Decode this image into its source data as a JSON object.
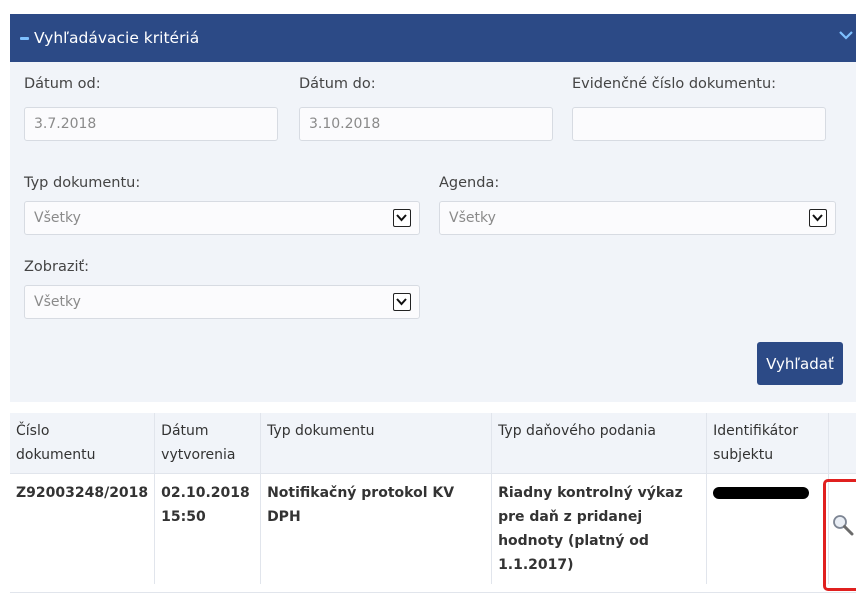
{
  "panel": {
    "title": "Vyhľadávacie kritériá",
    "accent_color": "#2c4a86"
  },
  "filters": {
    "date_from": {
      "label": "Dátum od:",
      "value": "3.7.2018"
    },
    "date_to": {
      "label": "Dátum do:",
      "value": "3.10.2018"
    },
    "evidence_number": {
      "label": "Evidenčné číslo dokumentu:",
      "value": ""
    },
    "document_type": {
      "label": "Typ dokumentu:",
      "value": "Všetky"
    },
    "agenda": {
      "label": "Agenda:",
      "value": "Všetky"
    },
    "show": {
      "label": "Zobraziť:",
      "value": "Všetky"
    }
  },
  "search_button": {
    "label": "Vyhľadať"
  },
  "table": {
    "headers": {
      "doc_number_1": "Číslo",
      "doc_number_2": "dokumentu",
      "created_1": "Dátum",
      "created_2": "vytvorenia",
      "doc_type": "Typ dokumentu",
      "filing_type": "Typ daňového podania",
      "subject_1": "Identifikátor",
      "subject_2": "subjektu"
    },
    "rows": [
      {
        "number": "Z92003248/2018",
        "date": "02.10.2018",
        "time": "15:50",
        "type_1": "Notifikačný protokol KV",
        "type_2": "DPH",
        "filing_1": "Riadny kontrolný výkaz",
        "filing_2": "pre daň z pridanej",
        "filing_3": "hodnoty (platný od",
        "filing_4": "1.1.2017)"
      }
    ]
  },
  "icons": {
    "collapse": "minus-icon",
    "chevron": "chevron-down-icon",
    "view": "magnifier-icon"
  },
  "highlight_color": "#e0201f"
}
